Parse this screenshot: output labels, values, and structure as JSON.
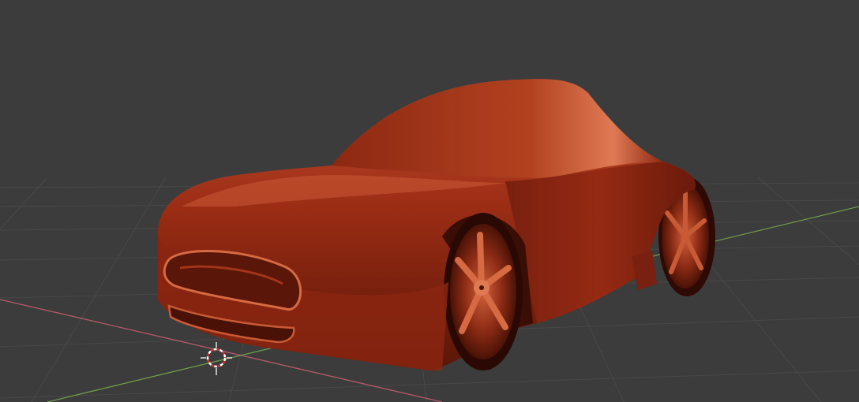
{
  "viewport": {
    "background_color": "#3c3c3c",
    "grid_color": "#4a4a4a",
    "x_axis_color": "#b45a6a",
    "y_axis_color": "#6f9a4a"
  },
  "model": {
    "subject": "car",
    "body_color": "#a33419",
    "highlight_color": "#e07a55",
    "shadow_color": "#3a0d05"
  },
  "cursor_3d": {
    "icon": "3d-cursor-icon",
    "ring_colors": [
      "#d03030",
      "#ffffff"
    ]
  }
}
